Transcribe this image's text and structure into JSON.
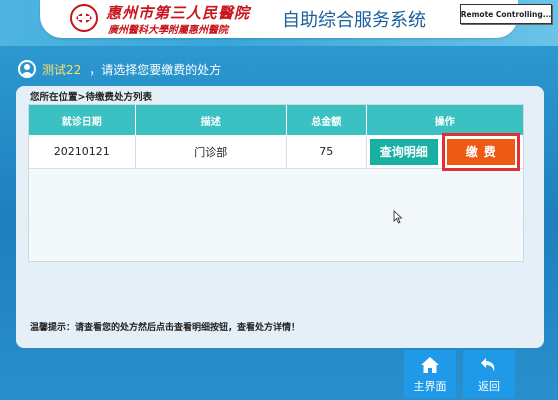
{
  "header": {
    "hospital_name_cn": "惠州市第三人民醫院",
    "hospital_affiliation": "廣州醫科大學附屬惠州醫院",
    "system_title": "自助综合服务系统",
    "remote_window_title": "Remote Controlling..."
  },
  "user": {
    "name": "测试22",
    "prompt": "，请选择您要缴费的处方"
  },
  "breadcrumb": "您所在位置>待缴费处方列表",
  "table": {
    "headers": [
      "就诊日期",
      "描述",
      "总金额",
      "操作"
    ],
    "rows": [
      {
        "date": "20210121",
        "description": "门诊部",
        "amount": "75",
        "detail_label": "查询明细",
        "pay_label": "缴费"
      }
    ]
  },
  "tip": "温馨提示：请查看您的处方然后点击查看明细按钮，查看处方详情！",
  "nav": {
    "home_label": "主界面",
    "back_label": "返回"
  },
  "colors": {
    "header_teal": "#3cc1c2",
    "detail_button": "#19b0a4",
    "pay_button": "#ee5a14",
    "highlight_red": "#e03030",
    "nav_button": "#1e9ae8",
    "brand_red": "#c8141c"
  }
}
